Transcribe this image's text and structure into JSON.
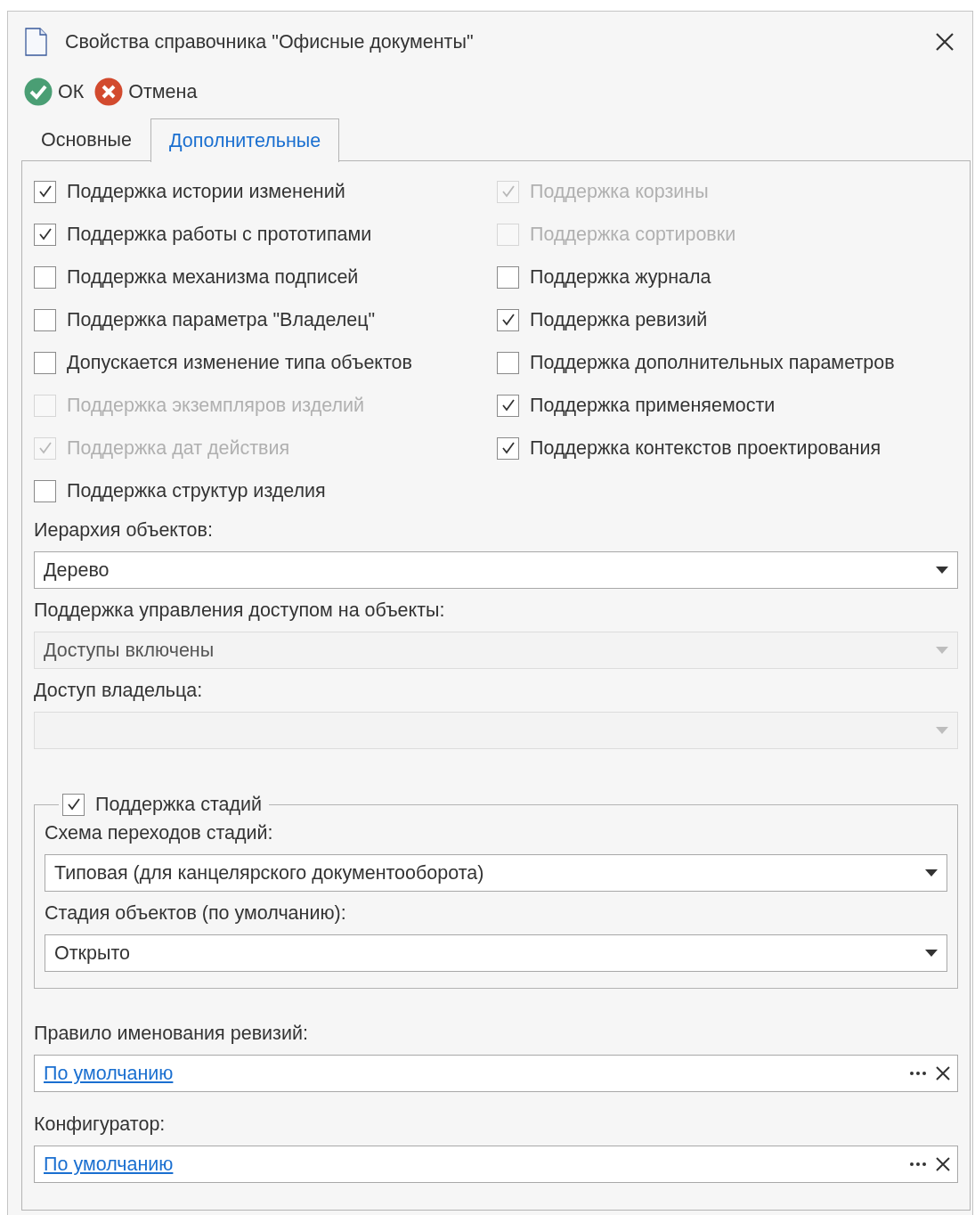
{
  "window": {
    "title": "Свойства справочника \"Офисные документы\""
  },
  "toolbar": [
    {
      "kind": "ok",
      "label": "ОК"
    },
    {
      "kind": "cancel",
      "label": "Отмена"
    }
  ],
  "tabs": [
    {
      "label": "Основные",
      "selected": false
    },
    {
      "label": "Дополнительные",
      "selected": true
    }
  ],
  "checkbox_columns": [
    {
      "items": [
        {
          "label": "Поддержка истории изменений",
          "checked": true,
          "disabled": false
        },
        {
          "label": "Поддержка работы с прототипами",
          "checked": true,
          "disabled": false
        },
        {
          "label": "Поддержка механизма подписей",
          "checked": false,
          "disabled": false
        },
        {
          "label": "Поддержка параметра \"Владелец\"",
          "checked": false,
          "disabled": false
        },
        {
          "label": "Допускается изменение типа объектов",
          "checked": false,
          "disabled": false
        },
        {
          "label": "Поддержка экземпляров изделий",
          "checked": false,
          "disabled": true
        },
        {
          "label": "Поддержка дат действия",
          "checked": true,
          "disabled": true
        },
        {
          "label": "Поддержка структур изделия",
          "checked": false,
          "disabled": false
        }
      ]
    },
    {
      "items": [
        {
          "label": "Поддержка корзины",
          "checked": true,
          "disabled": true
        },
        {
          "label": "Поддержка сортировки",
          "checked": false,
          "disabled": true
        },
        {
          "label": "Поддержка журнала",
          "checked": false,
          "disabled": false
        },
        {
          "label": "Поддержка ревизий",
          "checked": true,
          "disabled": false
        },
        {
          "label": "Поддержка дополнительных параметров",
          "checked": false,
          "disabled": false
        },
        {
          "label": "Поддержка применяемости",
          "checked": true,
          "disabled": false
        },
        {
          "label": "Поддержка контекстов проектирования",
          "checked": true,
          "disabled": false
        }
      ]
    }
  ],
  "dropdowns": [
    {
      "label": "Иерархия объектов:",
      "value": "Дерево",
      "disabled": false
    },
    {
      "label": "Поддержка управления доступом на объекты:",
      "value": "Доступы включены",
      "disabled": true
    },
    {
      "label": "Доступ владельца:",
      "disabled": true
    }
  ],
  "stages_group": {
    "label": "Поддержка стадий",
    "checked": true,
    "dropdowns": [
      {
        "label": "Схема переходов стадий:",
        "value": "Типовая (для канцелярского документооборота)",
        "disabled": false
      },
      {
        "label": "Стадия объектов (по умолчанию):",
        "value": "Открыто",
        "disabled": false
      }
    ]
  },
  "link_fields": [
    {
      "label": "Правило именования ревизий:",
      "value": "По умолчанию"
    },
    {
      "label": "Конфигуратор:",
      "value": "По умолчанию"
    }
  ]
}
